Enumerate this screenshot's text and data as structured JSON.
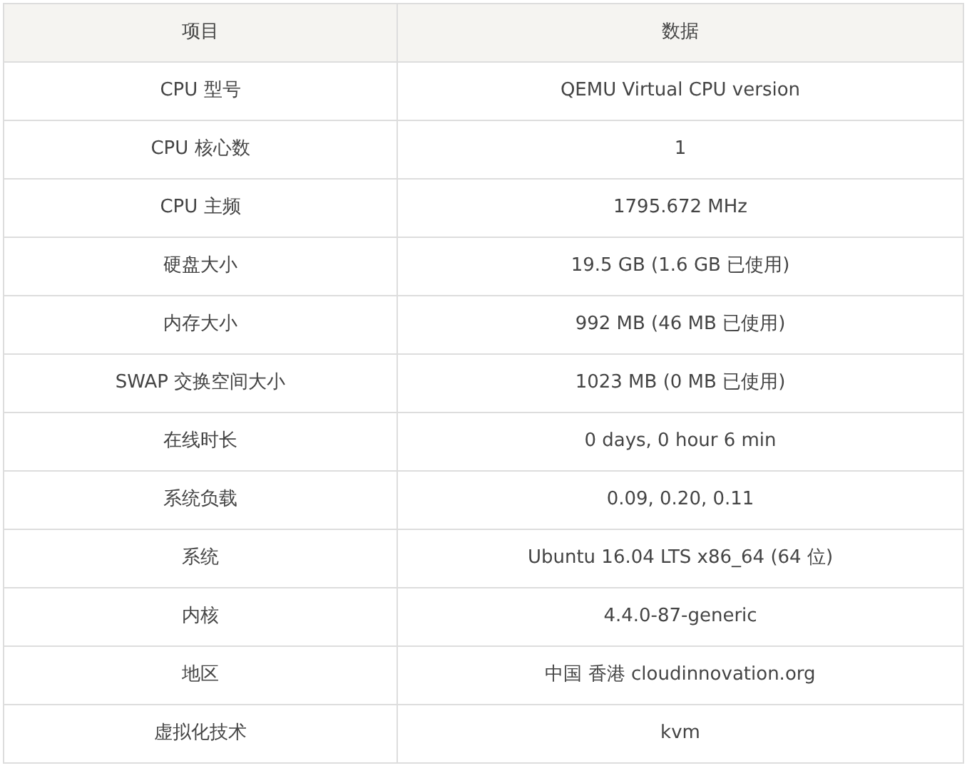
{
  "table": {
    "columns": [
      "项目",
      "数据"
    ],
    "rows": [
      [
        "CPU 型号",
        "QEMU Virtual CPU version"
      ],
      [
        "CPU 核心数",
        "1"
      ],
      [
        "CPU 主频",
        "1795.672 MHz"
      ],
      [
        "硬盘大小",
        "19.5 GB (1.6 GB 已使用)"
      ],
      [
        "内存大小",
        "992 MB (46 MB 已使用)"
      ],
      [
        "SWAP 交换空间大小",
        "1023 MB (0 MB 已使用)"
      ],
      [
        "在线时长",
        "0 days, 0 hour 6 min"
      ],
      [
        "系统负载",
        "0.09, 0.20, 0.11"
      ],
      [
        "系统",
        "Ubuntu 16.04 LTS x86_64 (64 位)"
      ],
      [
        "内核",
        "4.4.0-87-generic"
      ],
      [
        "地区",
        "中国 香港 cloudinnovation.org"
      ],
      [
        "虚拟化技术",
        "kvm"
      ]
    ]
  }
}
